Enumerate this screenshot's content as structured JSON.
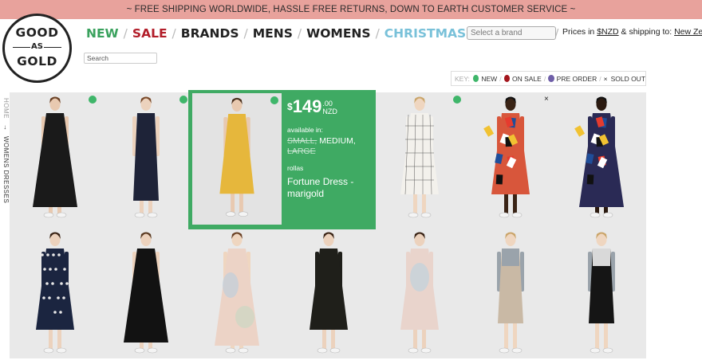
{
  "banner": {
    "text": "~ FREE SHIPPING WORLDWIDE, HASSLE FREE RETURNS, DOWN TO EARTH CUSTOMER SERVICE ~"
  },
  "logo": {
    "line1": "GOOD",
    "line2": "AS",
    "line3": "GOLD"
  },
  "nav": [
    {
      "label": "NEW",
      "color": "#3aa25e"
    },
    {
      "label": "SALE",
      "color": "#b21e2a"
    },
    {
      "label": "BRANDS",
      "color": "#222222"
    },
    {
      "label": "MENS",
      "color": "#222222"
    },
    {
      "label": "WOMENS",
      "color": "#222222"
    },
    {
      "label": "CHRISTMAS GIFT GUIDE",
      "color": "#79c1d9"
    }
  ],
  "brand_select": {
    "placeholder": "Select a brand"
  },
  "prices": {
    "prefix": "Prices in",
    "currency": "$NZD",
    "middle": "& shipping to:",
    "country": "New Zealand"
  },
  "search": {
    "placeholder": "Search"
  },
  "key": {
    "label": "KEY:",
    "items": [
      {
        "label": "NEW",
        "color": "#3fb66a"
      },
      {
        "label": "ON SALE",
        "color": "#a3161d"
      },
      {
        "label": "PRE ORDER",
        "color": "#6f5fa8"
      },
      {
        "label": "SOLD OUT",
        "symbol": "×"
      }
    ]
  },
  "breadcrumb": {
    "home": "HOME",
    "arrow": "→",
    "current": "WOMENS DRESSES"
  },
  "highlight": {
    "price_dollar": "$",
    "price_whole": "149",
    "price_cents": ".00",
    "price_currency": "NZD",
    "available_label": "available in:",
    "sizes_sold": "SMALL,",
    "sizes_available": "MEDIUM,",
    "sizes_sold2": "LARGE",
    "brand": "rollas",
    "name": "Fortune Dress - marigold"
  },
  "products": [
    {
      "row": 0,
      "col": 0,
      "badge": "new",
      "dress": "#1a1a1a",
      "style": "maxi",
      "skin": "#e8c9b0",
      "hair": "#6b4226"
    },
    {
      "row": 0,
      "col": 1,
      "badge": "new",
      "dress": "#1e2338",
      "style": "slip",
      "skin": "#ecd2bd",
      "hair": "#7a4a2a"
    },
    {
      "row": 0,
      "col": 2,
      "badge": "new",
      "dress": "#e6b73c",
      "style": "back",
      "skin": "#e8c9b0",
      "hair": "#4a2f1c"
    },
    {
      "row": 0,
      "col": 4,
      "badge": "new",
      "dress": "#f3f1ec",
      "style": "wrap",
      "skin": "#efd6c0",
      "hair": "#caa56a"
    },
    {
      "row": 0,
      "col": 5,
      "badge": "none",
      "dress": "#d8563b",
      "style": "print",
      "skin": "#3a2416",
      "hair": "#111111"
    },
    {
      "row": 0,
      "col": 6,
      "badge": "sold",
      "dress": "#2a2a55",
      "style": "print2",
      "skin": "#2b1a10",
      "hair": "#111111"
    },
    {
      "row": 1,
      "col": 0,
      "badge": "none",
      "dress": "#1b2540",
      "style": "floral",
      "skin": "#ecd2bd",
      "hair": "#3a2416"
    },
    {
      "row": 1,
      "col": 1,
      "badge": "none",
      "dress": "#121212",
      "style": "maxi",
      "skin": "#ecd2bd",
      "hair": "#5a3a22"
    },
    {
      "row": 1,
      "col": 2,
      "badge": "none",
      "dress": "#ecd3c6",
      "style": "tiedye",
      "skin": "#efd6c0",
      "hair": "#6b4226"
    },
    {
      "row": 1,
      "col": 3,
      "badge": "none",
      "dress": "#1f1f1a",
      "style": "tunic",
      "skin": "#ecd2bd",
      "hair": "#3a2416"
    },
    {
      "row": 1,
      "col": 4,
      "badge": "none",
      "dress": "#e9d4cc",
      "style": "tunic2",
      "skin": "#ecd2bd",
      "hair": "#3a2416"
    },
    {
      "row": 1,
      "col": 5,
      "badge": "none",
      "dress": "#c9b9a5",
      "style": "apron",
      "skin": "#efd6c0",
      "hair": "#caa56a"
    },
    {
      "row": 1,
      "col": 6,
      "badge": "none",
      "dress": "#151515",
      "style": "apron2",
      "skin": "#efd6c0",
      "hair": "#caa56a"
    }
  ]
}
